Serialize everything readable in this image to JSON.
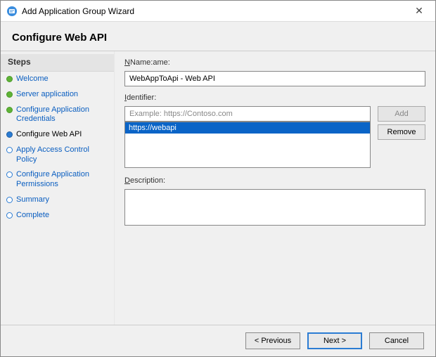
{
  "titlebar": {
    "title": "Add Application Group Wizard",
    "close_label": "✕"
  },
  "header": {
    "heading": "Configure Web API"
  },
  "sidebar": {
    "heading": "Steps",
    "items": [
      {
        "label": "Welcome",
        "state": "done"
      },
      {
        "label": "Server application",
        "state": "done"
      },
      {
        "label": "Configure Application Credentials",
        "state": "done"
      },
      {
        "label": "Configure Web API",
        "state": "current"
      },
      {
        "label": "Apply Access Control Policy",
        "state": "pending"
      },
      {
        "label": "Configure Application Permissions",
        "state": "pending"
      },
      {
        "label": "Summary",
        "state": "pending"
      },
      {
        "label": "Complete",
        "state": "pending"
      }
    ]
  },
  "form": {
    "name_label": "Name:",
    "name_value": "WebAppToApi - Web API",
    "identifier_label": "Identifier:",
    "identifier_placeholder": "Example: https://Contoso.com",
    "identifier_value": "",
    "identifier_items": [
      {
        "value": "https://webapi",
        "selected": true
      }
    ],
    "add_btn": "Add",
    "remove_btn": "Remove",
    "description_label": "Description:",
    "description_value": ""
  },
  "footer": {
    "previous": "< Previous",
    "next": "Next >",
    "cancel": "Cancel"
  }
}
